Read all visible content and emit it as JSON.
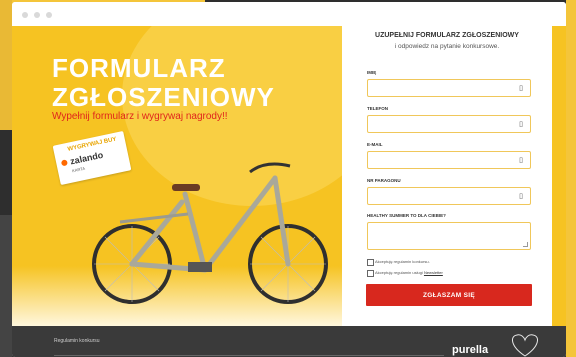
{
  "hero": {
    "headline_line1": "FORMULARZ",
    "headline_line2": "ZGŁOSZENIOWY",
    "subtitle": "Wypełnij formularz i wygrywaj nagrody!!",
    "voucher": {
      "top_text": "WYGRYWAJ BUY",
      "brand": "zalando",
      "small_text": "KARTA"
    }
  },
  "form": {
    "heading": "UZUPEŁNIJ FORMULARZ ZGŁOSZENIOWY",
    "subheading": "i odpowiedz na pytanie konkursowe.",
    "fields": [
      {
        "label": "IMIĘ",
        "value": "",
        "icon": "id-card-icon"
      },
      {
        "label": "TELEFON",
        "value": "",
        "icon": "id-card-icon"
      },
      {
        "label": "E-MAIL",
        "value": "",
        "icon": "id-card-icon"
      },
      {
        "label": "NR PARAGONU",
        "value": "",
        "icon": "id-card-icon"
      }
    ],
    "question_label": "HEALTHY SUMMER TO DLA CIEBIE?",
    "question_value": "",
    "consent1": "Akceptuję regulamin konkursu.",
    "consent2_prefix": "Akceptuję regulamin usługi",
    "consent2_link": "Newsletter",
    "submit_label": "ZGŁASZAM SIĘ"
  },
  "footer": {
    "link": "Regulamin konkursu",
    "logo": "purella"
  },
  "colors": {
    "accent_yellow": "#f6c322",
    "submit_red": "#d8281e",
    "footer_dark": "#3a3a3a"
  }
}
